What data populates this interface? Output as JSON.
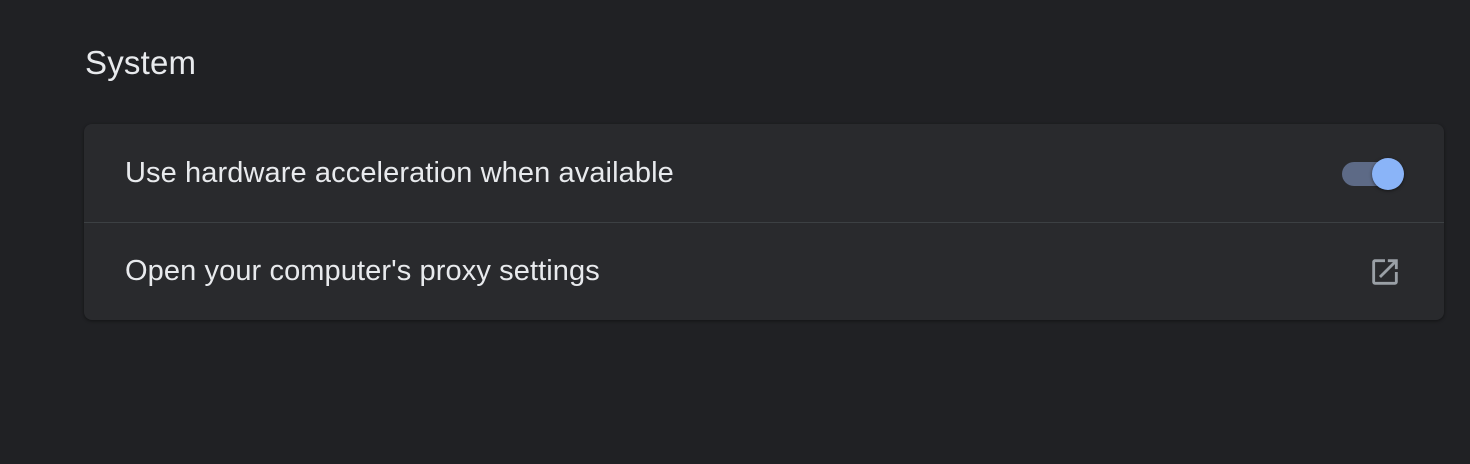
{
  "section": {
    "title": "System"
  },
  "settings": {
    "hardware_acceleration": {
      "label": "Use hardware acceleration when available",
      "enabled": true
    },
    "proxy": {
      "label": "Open your computer's proxy settings",
      "icon": "open-in-new-icon"
    }
  },
  "colors": {
    "background": "#202124",
    "card": "#292a2d",
    "text": "#e8eaed",
    "toggle_on_knob": "#8ab4f8",
    "toggle_on_track": "#5d6a86",
    "icon": "#9aa0a6"
  }
}
